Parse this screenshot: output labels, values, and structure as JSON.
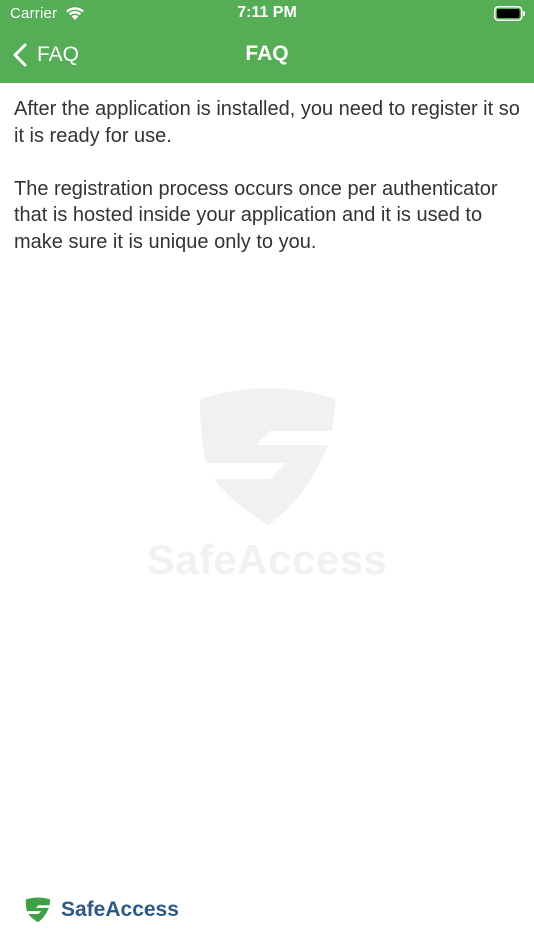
{
  "status_bar": {
    "carrier": "Carrier",
    "time": "7:11 PM"
  },
  "nav": {
    "back_label": "FAQ",
    "title": "FAQ"
  },
  "content": {
    "paragraphs": [
      "After the application is installed, you need to register it so it is ready for use.",
      "The registration process occurs once per authenticator that is hosted inside your application and it is used to make sure it is unique only to you."
    ]
  },
  "watermark": {
    "brand": "SafeAccess"
  },
  "footer": {
    "brand": "SafeAccess"
  },
  "colors": {
    "header_background": "#55ae55",
    "brand_green": "#3fa047",
    "brand_blue": "#2c5a86",
    "watermark": "#f1f1f1"
  }
}
